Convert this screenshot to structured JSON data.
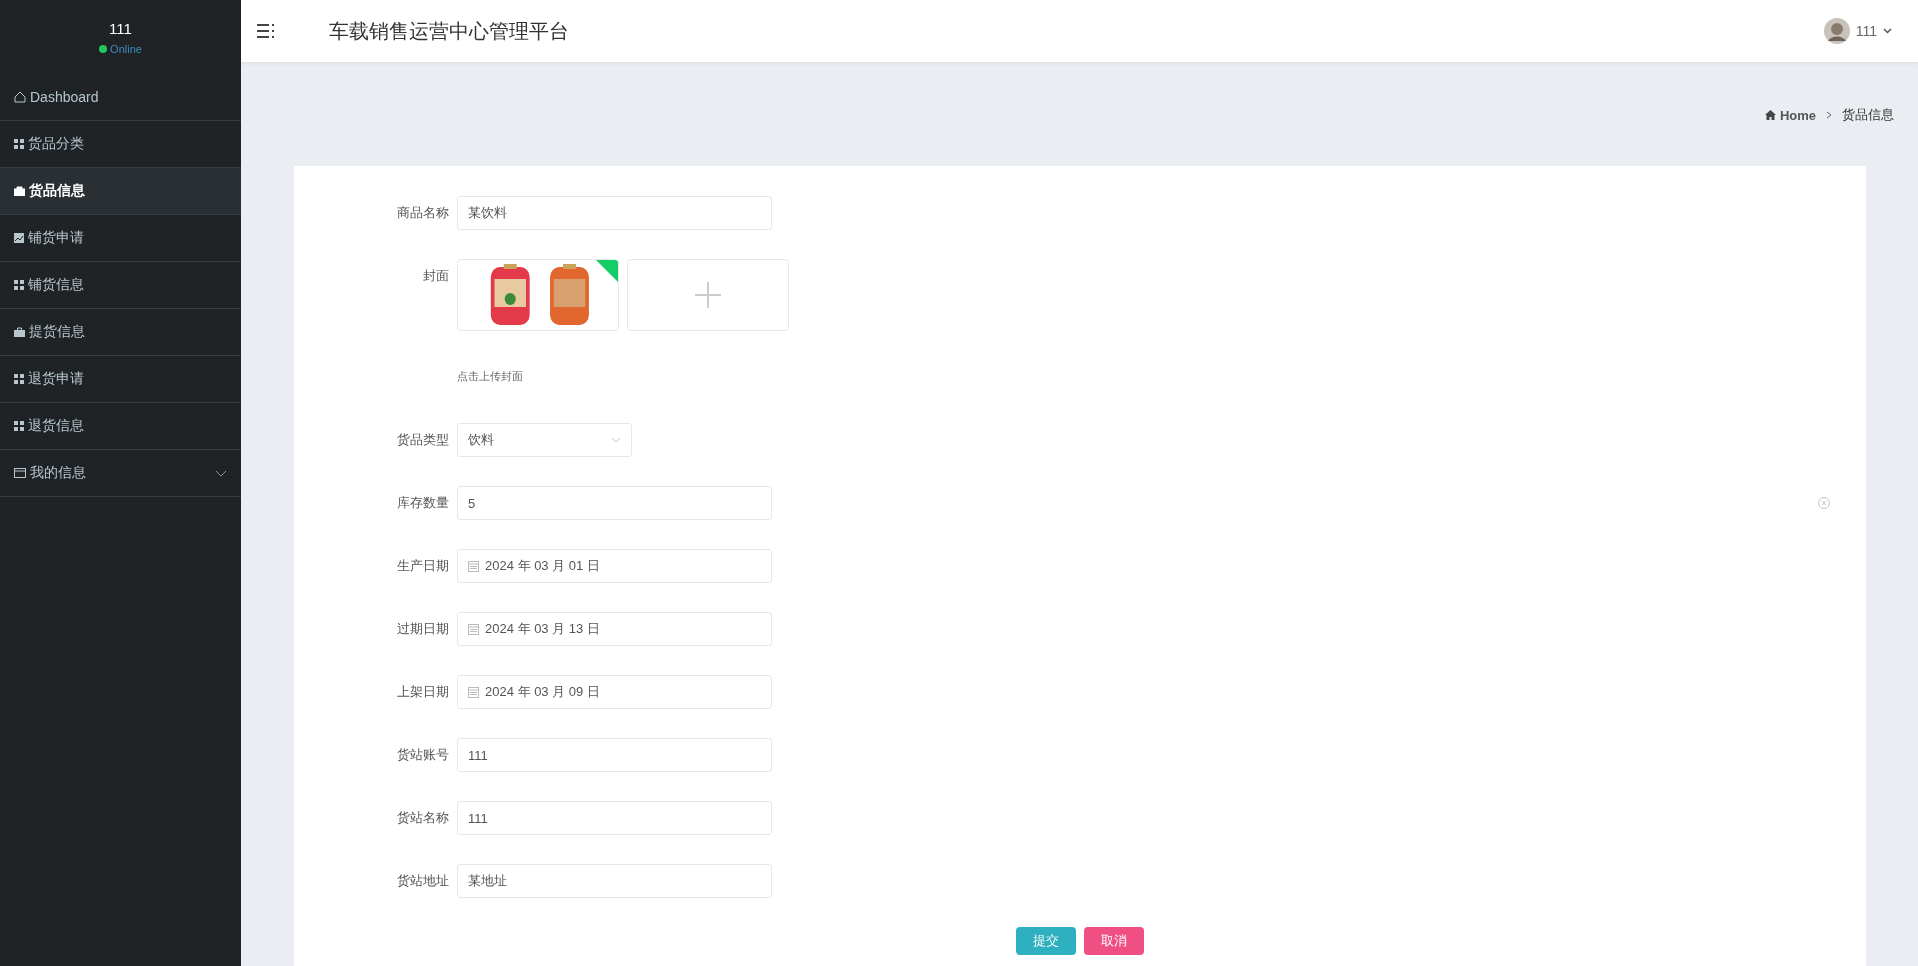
{
  "sidebar": {
    "user": {
      "name": "111",
      "status": "Online"
    },
    "items": [
      {
        "label": "Dashboard",
        "kind": "home",
        "selected": false,
        "expandable": false
      },
      {
        "label": "货品分类",
        "kind": "grid",
        "selected": false,
        "expandable": false
      },
      {
        "label": "货品信息",
        "kind": "bag",
        "selected": true,
        "expandable": false
      },
      {
        "label": "铺货申请",
        "kind": "chart",
        "selected": false,
        "expandable": false
      },
      {
        "label": "铺货信息",
        "kind": "grid",
        "selected": false,
        "expandable": false
      },
      {
        "label": "提货信息",
        "kind": "briefcase",
        "selected": false,
        "expandable": false
      },
      {
        "label": "退货申请",
        "kind": "grid",
        "selected": false,
        "expandable": false
      },
      {
        "label": "退货信息",
        "kind": "grid",
        "selected": false,
        "expandable": false
      },
      {
        "label": "我的信息",
        "kind": "window",
        "selected": false,
        "expandable": true
      }
    ]
  },
  "header": {
    "title": "车载销售运营中心管理平台",
    "user": "111"
  },
  "breadcrumb": [
    "Home",
    "货品信息"
  ],
  "form": {
    "fields": [
      {
        "kind": "text",
        "label": "商品名称",
        "value": "某饮料"
      },
      {
        "kind": "upload",
        "label": "封面",
        "hint": "点击上传封面",
        "uploaded": true
      },
      {
        "kind": "select",
        "label": "货品类型",
        "value": "饮料"
      },
      {
        "kind": "text",
        "label": "库存数量",
        "value": "5",
        "clearable": true
      },
      {
        "kind": "date",
        "label": "生产日期",
        "value": "2024 年 03 月 01 日"
      },
      {
        "kind": "date",
        "label": "过期日期",
        "value": "2024 年 03 月 13 日"
      },
      {
        "kind": "date",
        "label": "上架日期",
        "value": "2024 年 03 月 09 日"
      },
      {
        "kind": "text",
        "label": "货站账号",
        "value": "111"
      },
      {
        "kind": "text",
        "label": "货站名称",
        "value": "111"
      },
      {
        "kind": "text",
        "label": "货站地址",
        "value": "某地址"
      }
    ]
  },
  "buttons": [
    {
      "label": "提交",
      "kind": "primary"
    },
    {
      "label": "取消",
      "kind": "danger"
    }
  ]
}
